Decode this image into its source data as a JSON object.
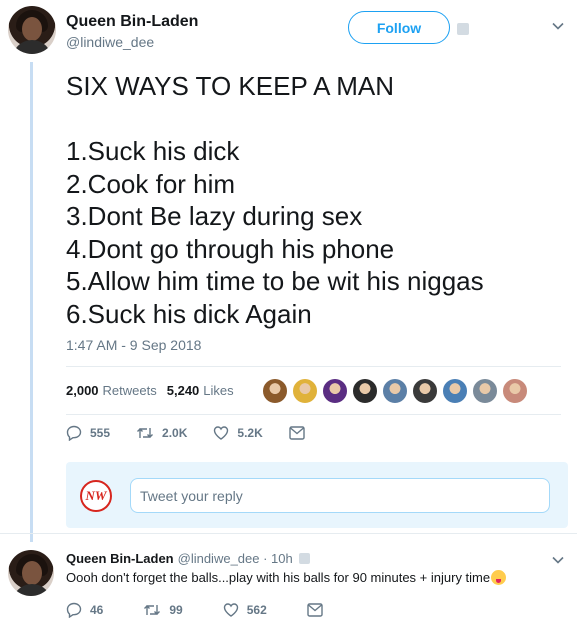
{
  "tweet": {
    "author_name": "Queen Bin-Laden",
    "author_handle": "@lindiwe_dee",
    "follow_label": "Follow",
    "title": "SIX WAYS TO KEEP A MAN",
    "lines": [
      "1.Suck his dick",
      "2.Cook for him",
      "3.Dont Be lazy during sex",
      "4.Dont go through his phone",
      "5.Allow him time to be wit his niggas",
      "6.Suck his dick Again"
    ],
    "timestamp": "1:47 AM - 9 Sep 2018",
    "retweets_count": "2,000",
    "retweets_label": "Retweets",
    "likes_count": "5,240",
    "likes_label": "Likes",
    "liker_colors": [
      "#8b5a2b",
      "#e0b23a",
      "#5a2d82",
      "#2b2b2b",
      "#5b7fa6",
      "#3a3a3a",
      "#4a7fb5",
      "#7a8a99",
      "#c88a7a"
    ],
    "actions": {
      "replies": "555",
      "retweets": "2.0K",
      "likes": "5.2K"
    }
  },
  "reply_box": {
    "logo_text": "NW",
    "placeholder": "Tweet your reply"
  },
  "reply": {
    "author_name": "Queen Bin-Laden",
    "meta": "@lindiwe_dee · 10h",
    "text": "Oooh don't forget the balls...play with his balls for 90 minutes + injury time",
    "actions": {
      "replies": "46",
      "retweets": "99",
      "likes": "562"
    }
  },
  "colors": {
    "accent": "#1da1f2",
    "muted": "#657786",
    "text": "#14171a",
    "thread_line": "#c7ddf3",
    "reply_bg": "#e8f5fd"
  }
}
